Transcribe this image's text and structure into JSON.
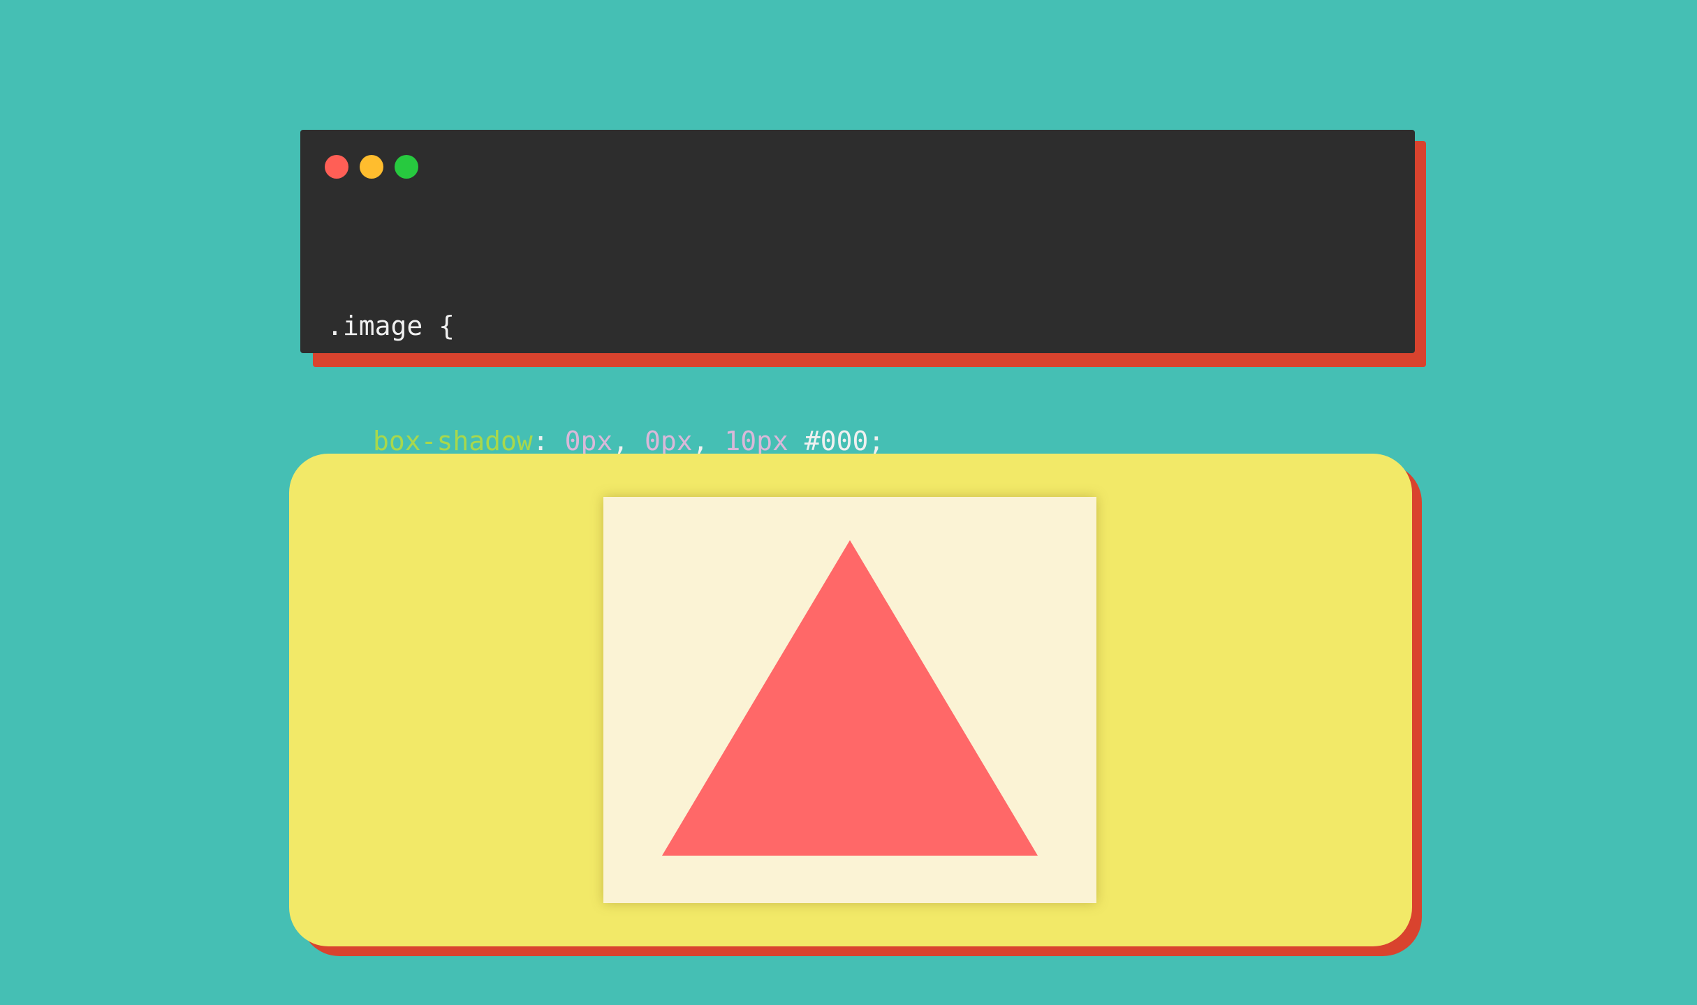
{
  "colors": {
    "background": "#45bfb4",
    "offset_shadow": "#d9432e",
    "code_bg": "#2d2d2d",
    "dot_red": "#ff5f56",
    "dot_yellow": "#ffbd2e",
    "dot_green": "#27c93f",
    "code_text": "#f0f0f0",
    "code_property": "#a8d84c",
    "code_number": "#d9b8d9",
    "card_bg": "#f2e968",
    "image_bg": "#fbf3d5",
    "triangle": "#ff6868"
  },
  "window_controls": [
    "close-icon",
    "minimize-icon",
    "maximize-icon"
  ],
  "code": {
    "selector": ".image {",
    "property": "box-shadow",
    "colon": ":",
    "value_1": "0px",
    "comma_1": ",",
    "value_2": "0px",
    "comma_2": ",",
    "value_3": "10px",
    "color_value": "#000;",
    "closing": "}"
  },
  "preview": {
    "shape": "triangle-icon"
  }
}
